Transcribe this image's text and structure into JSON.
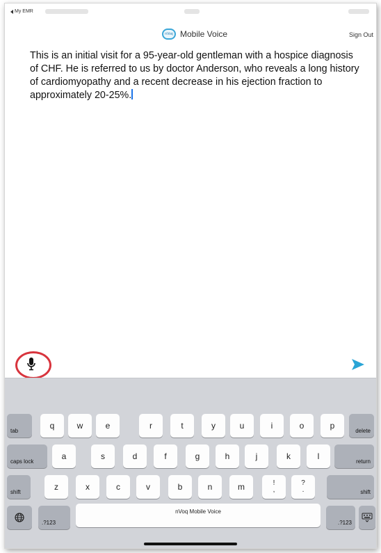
{
  "status_bar": {
    "back_label": "My EMR"
  },
  "nav": {
    "app_name": "Mobile Voice",
    "logo_text": "nVoq",
    "sign_out_label": "Sign Out"
  },
  "note": {
    "text": "This is an initial visit for a 95-year-old gentleman with a hospice diagnosis of CHF. He is referred to us by doctor Anderson, who reveals a long history of cardiomyopathy and a recent decrease in his ejection fraction to approximately 20-25%."
  },
  "toolbar": {
    "mic_icon": "microphone-icon",
    "send_icon": "send-icon",
    "accent": "#2aa5d6",
    "highlight": "#d8343d"
  },
  "keyboard": {
    "tab": "tab",
    "caps_lock": "caps lock",
    "shift": "shift",
    "delete": "delete",
    "return": "return",
    "num_left": ".?123",
    "num_right": ".?123",
    "space": "nVoq Mobile Voice",
    "globe_icon": "globe-icon",
    "dismiss_icon": "keyboard-dismiss-icon",
    "row1": [
      "q",
      "w",
      "e",
      "r",
      "t",
      "y",
      "u",
      "i",
      "o",
      "p"
    ],
    "row2": [
      "a",
      "s",
      "d",
      "f",
      "g",
      "h",
      "j",
      "k",
      "l"
    ],
    "row3": [
      "z",
      "x",
      "c",
      "v",
      "b",
      "n",
      "m"
    ],
    "row3_punct": [
      {
        "top": "!",
        "bottom": ","
      },
      {
        "top": "?",
        "bottom": "."
      }
    ]
  }
}
